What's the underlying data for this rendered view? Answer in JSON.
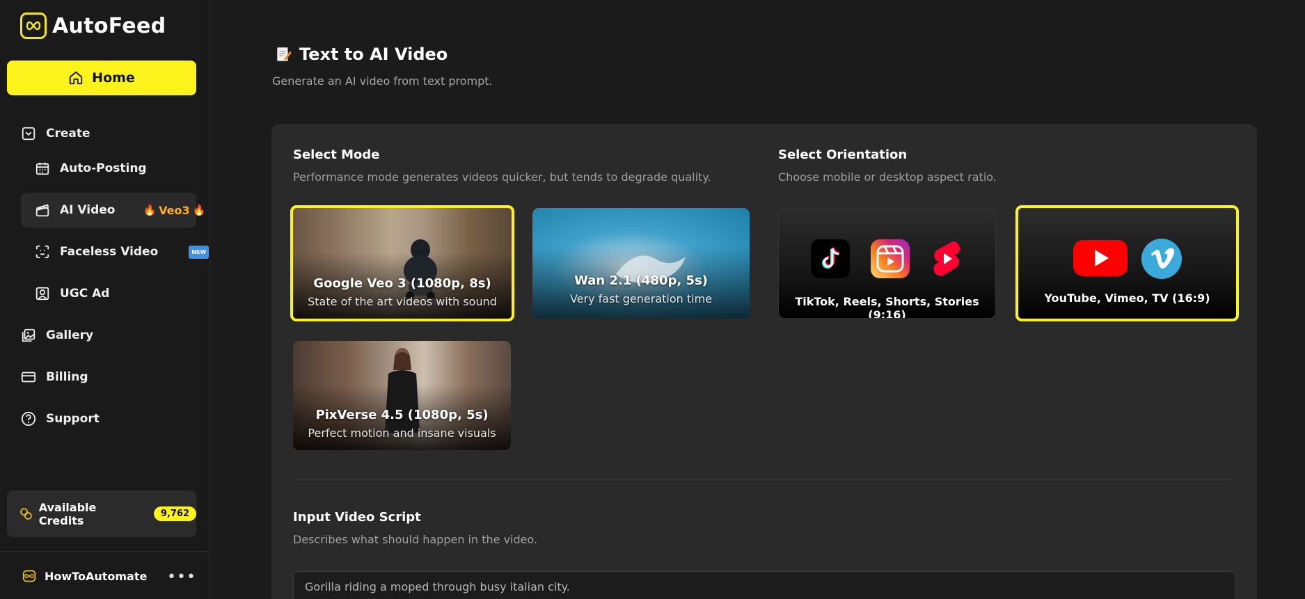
{
  "app": {
    "name": "AutoFeed"
  },
  "sidebar": {
    "home_label": "Home",
    "create_label": "Create",
    "items": [
      {
        "label": "Auto-Posting"
      },
      {
        "label": "AI Video",
        "tag": "Veo3"
      },
      {
        "label": "Faceless Video",
        "badge": "NEW"
      },
      {
        "label": "UGC Ad"
      }
    ],
    "gallery_label": "Gallery",
    "billing_label": "Billing",
    "support_label": "Support",
    "credits": {
      "label": "Available Credits",
      "value": "9,762"
    },
    "user": {
      "name": "HowToAutomate",
      "more": "•••"
    }
  },
  "page": {
    "title": "Text to AI Video",
    "subtitle": "Generate an AI video from text prompt."
  },
  "mode": {
    "title": "Select Mode",
    "subtitle": "Performance mode generates videos quicker, but tends to degrade quality.",
    "options": [
      {
        "title": "Google Veo 3 (1080p, 8s)",
        "sub": "State of the art videos with sound",
        "selected": true
      },
      {
        "title": "Wan 2.1 (480p, 5s)",
        "sub": "Very fast generation time",
        "selected": false
      },
      {
        "title": "PixVerse 4.5 (1080p, 5s)",
        "sub": "Perfect motion and insane visuals",
        "selected": false
      }
    ]
  },
  "orientation": {
    "title": "Select Orientation",
    "subtitle": "Choose mobile or desktop aspect ratio.",
    "options": [
      {
        "label": "TikTok, Reels, Shorts, Stories (9:16)",
        "selected": false,
        "icons": [
          "tiktok-icon",
          "instagram-reels-icon",
          "youtube-shorts-icon"
        ]
      },
      {
        "label": "YouTube, Vimeo, TV (16:9)",
        "selected": true,
        "icons": [
          "youtube-icon",
          "vimeo-icon"
        ]
      }
    ]
  },
  "script": {
    "title": "Input Video Script",
    "subtitle": "Describes what should happen in the video.",
    "value": "Gorilla riding a moped through busy italian city."
  },
  "colors": {
    "accent": "#fbf31b",
    "background": "#1b1b1b",
    "panel": "#2a2a2a"
  }
}
